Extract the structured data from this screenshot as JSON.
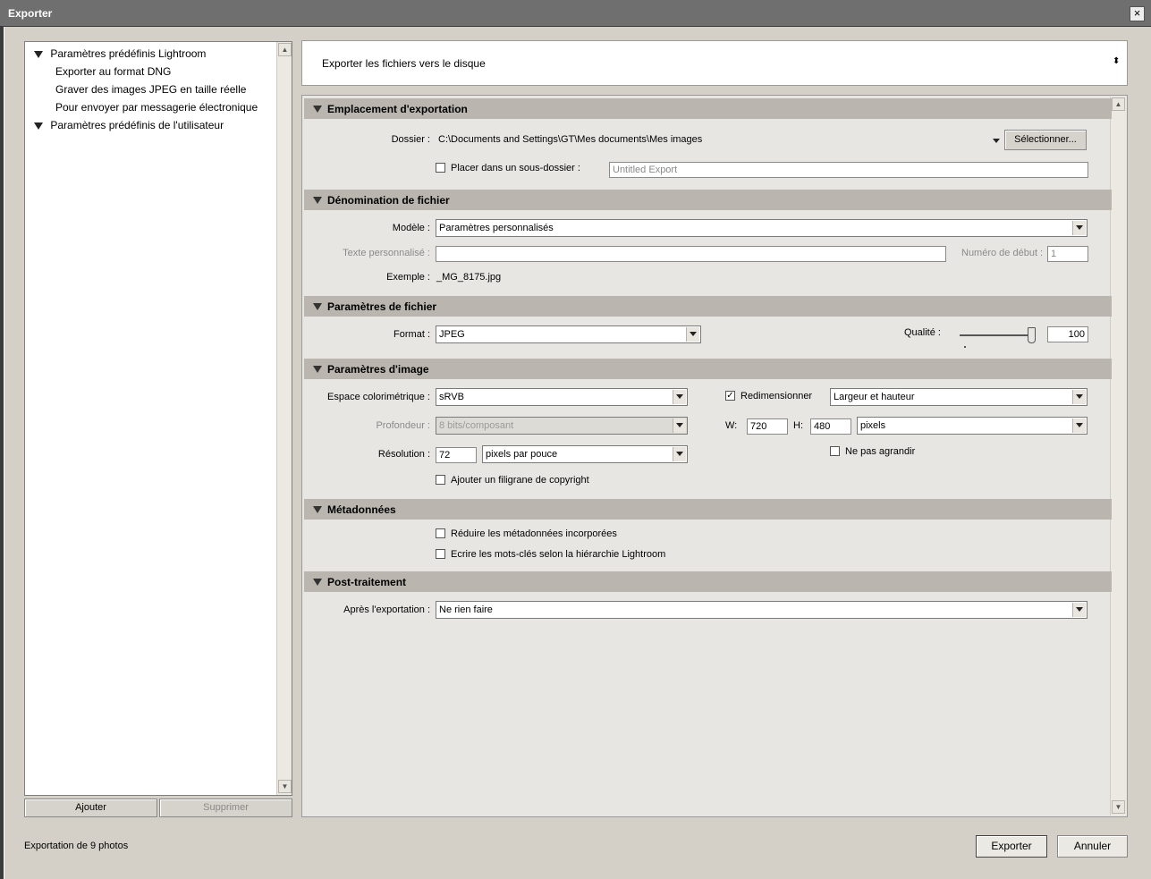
{
  "window": {
    "title": "Exporter",
    "close_label": "×"
  },
  "presets": {
    "groups": [
      {
        "label": "Paramètres prédéfinis Lightroom",
        "items": [
          "Exporter au format DNG",
          "Graver des images JPEG en taille réelle",
          "Pour envoyer par messagerie électronique"
        ]
      },
      {
        "label": "Paramètres prédéfinis de l'utilisateur",
        "items": []
      }
    ],
    "add_label": "Ajouter",
    "remove_label": "Supprimer"
  },
  "destination": {
    "label": "Exporter les fichiers vers le disque",
    "arrow": "⬍"
  },
  "sections": {
    "location": {
      "title": "Emplacement d'exportation",
      "folder_label": "Dossier :",
      "folder_value": "C:\\Documents and Settings\\GT\\Mes documents\\Mes images",
      "select_button": "Sélectionner...",
      "subfolder_label": "Placer dans un sous-dossier :",
      "subfolder_checked": false,
      "subfolder_placeholder": "Untitled Export"
    },
    "naming": {
      "title": "Dénomination de fichier",
      "template_label": "Modèle :",
      "template_value": "Paramètres personnalisés",
      "custom_text_label": "Texte personnalisé :",
      "start_number_label": "Numéro de début :",
      "start_number_value": "1",
      "example_label": "Exemple :",
      "example_value": "_MG_8175.jpg"
    },
    "file_settings": {
      "title": "Paramètres de fichier",
      "format_label": "Format :",
      "format_value": "JPEG",
      "quality_label": "Qualité :",
      "quality_value": "100",
      "quality_level": 100
    },
    "image_settings": {
      "title": "Paramètres d'image",
      "colorspace_label": "Espace colorimétrique :",
      "colorspace_value": "sRVB",
      "depth_label": "Profondeur :",
      "depth_value": "8 bits/composant",
      "resolution_label": "Résolution :",
      "resolution_value": "72",
      "resolution_unit": "pixels par pouce",
      "watermark_label": "Ajouter un filigrane de copyright",
      "watermark_checked": false,
      "resize_label": "Redimensionner",
      "resize_checked": true,
      "resize_mode": "Largeur et hauteur",
      "w_label": "W:",
      "w_value": "720",
      "h_label": "H:",
      "h_value": "480",
      "size_unit": "pixels",
      "no_enlarge_label": "Ne pas agrandir",
      "no_enlarge_checked": false
    },
    "metadata": {
      "title": "Métadonnées",
      "minimize_label": "Réduire les métadonnées incorporées",
      "minimize_checked": false,
      "keywords_label": "Ecrire les mots-clés selon la hiérarchie Lightroom",
      "keywords_checked": false
    },
    "post": {
      "title": "Post-traitement",
      "after_label": "Après l'exportation :",
      "after_value": "Ne rien faire"
    }
  },
  "footer": {
    "status": "Exportation de 9 photos",
    "export_button": "Exporter",
    "cancel_button": "Annuler"
  }
}
